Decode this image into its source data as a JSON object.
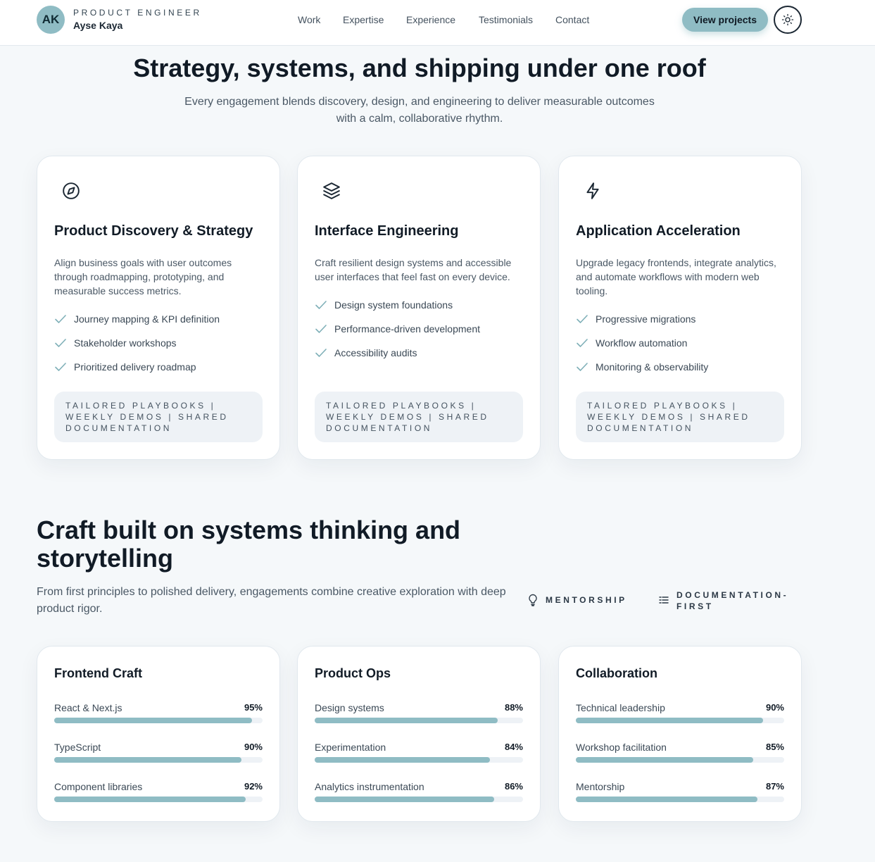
{
  "header": {
    "avatar_initials": "AK",
    "role": "PRODUCT ENGINEER",
    "name": "Ayse Kaya",
    "nav": [
      "Work",
      "Expertise",
      "Experience",
      "Testimonials",
      "Contact"
    ],
    "cta_label": "View projects",
    "theme_icon": "sun-icon"
  },
  "services": {
    "title": "Strategy, systems, and shipping under one roof",
    "subtitle": "Every engagement blends discovery, design, and engineering to deliver measurable outcomes with a calm, collaborative rhythm.",
    "cards": [
      {
        "icon": "compass-icon",
        "title": "Product Discovery & Strategy",
        "description": "Align business goals with user outcomes through roadmapping, prototyping, and measurable success metrics.",
        "items": [
          "Journey mapping & KPI definition",
          "Stakeholder workshops",
          "Prioritized delivery roadmap"
        ],
        "tag": "Tailored playbooks | Weekly demos | Shared documentation"
      },
      {
        "icon": "layers-icon",
        "title": "Interface Engineering",
        "description": "Craft resilient design systems and accessible user interfaces that feel fast on every device.",
        "items": [
          "Design system foundations",
          "Performance-driven development",
          "Accessibility audits"
        ],
        "tag": "Tailored playbooks | Weekly demos | Shared documentation"
      },
      {
        "icon": "lightning-icon",
        "title": "Application Acceleration",
        "description": "Upgrade legacy frontends, integrate analytics, and automate workflows with modern web tooling.",
        "items": [
          "Progressive migrations",
          "Workflow automation",
          "Monitoring & observability"
        ],
        "tag": "Tailored playbooks | Weekly demos | Shared documentation"
      }
    ]
  },
  "expertise": {
    "title": "Craft built on systems thinking and storytelling",
    "subtitle": "From first principles to polished delivery, engagements combine creative exploration with deep product rigor.",
    "badges": [
      {
        "icon": "lightbulb-icon",
        "label": "MENTORSHIP"
      },
      {
        "icon": "document-list-icon",
        "label": "DOCUMENTATION-FIRST"
      }
    ],
    "groups": [
      {
        "title": "Frontend Craft",
        "skills": [
          {
            "label": "React & Next.js",
            "value": 95,
            "display": "95%"
          },
          {
            "label": "TypeScript",
            "value": 90,
            "display": "90%"
          },
          {
            "label": "Component libraries",
            "value": 92,
            "display": "92%"
          }
        ]
      },
      {
        "title": "Product Ops",
        "skills": [
          {
            "label": "Design systems",
            "value": 88,
            "display": "88%"
          },
          {
            "label": "Experimentation",
            "value": 84,
            "display": "84%"
          },
          {
            "label": "Analytics instrumentation",
            "value": 86,
            "display": "86%"
          }
        ]
      },
      {
        "title": "Collaboration",
        "skills": [
          {
            "label": "Technical leadership",
            "value": 90,
            "display": "90%"
          },
          {
            "label": "Workshop facilitation",
            "value": 85,
            "display": "85%"
          },
          {
            "label": "Mentorship",
            "value": 87,
            "display": "87%"
          }
        ]
      }
    ]
  },
  "colors": {
    "accent": "#8fbcc4",
    "check": "#7fb0b8",
    "text_dark": "#111b26"
  }
}
